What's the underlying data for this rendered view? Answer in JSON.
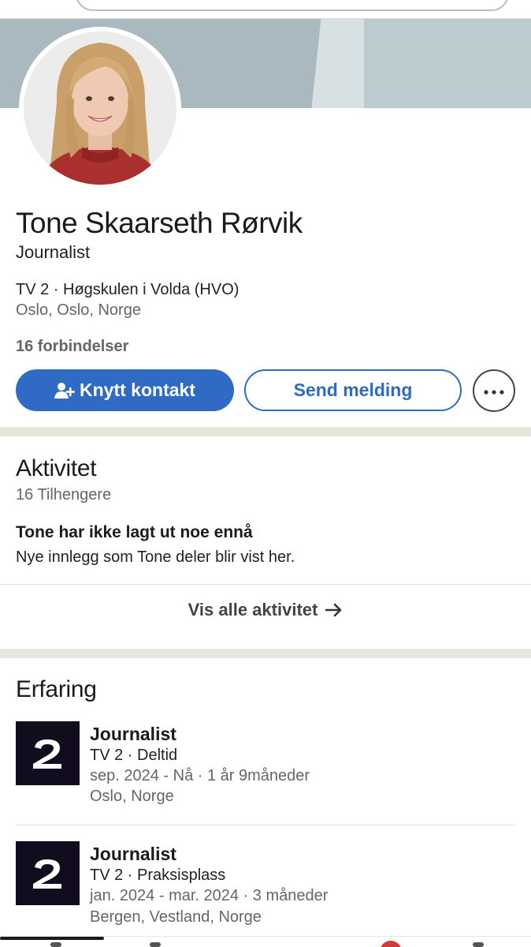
{
  "profile": {
    "name": "Tone Skaarseth Rørvik",
    "headline": "Journalist",
    "education_company": "TV 2 · Høgskulen i Volda (HVO)",
    "location": "Oslo, Oslo, Norge",
    "connections": "16 forbindelser"
  },
  "actions": {
    "connect_label": "Knytt kontakt",
    "message_label": "Send melding",
    "more_icon": "more-dots-icon"
  },
  "activity": {
    "title": "Aktivitet",
    "followers": "16 Tilhengere",
    "empty_title": "Tone har ikke lagt ut noe ennå",
    "empty_text": "Nye innlegg som Tone deler blir vist her.",
    "show_all": "Vis alle aktivitet"
  },
  "experience": {
    "title": "Erfaring",
    "items": [
      {
        "role": "Journalist",
        "company": "TV 2 · Deltid",
        "dates": "sep. 2024 - Nå · 1 år 9måneder",
        "location": "Oslo, Norge",
        "logo": "tv2-logo"
      },
      {
        "role": "Journalist",
        "company": "TV 2 · Praksisplass",
        "dates": "jan. 2024 - mar. 2024 · 3 måneder",
        "location": "Bergen, Vestland, Norge",
        "logo": "tv2-logo"
      }
    ]
  },
  "colors": {
    "primary": "#2f6bc4",
    "cover": "#a9b9bf",
    "divider": "#e8e5e0",
    "logo_bg": "#120c1f",
    "badge": "#d23c3c"
  }
}
